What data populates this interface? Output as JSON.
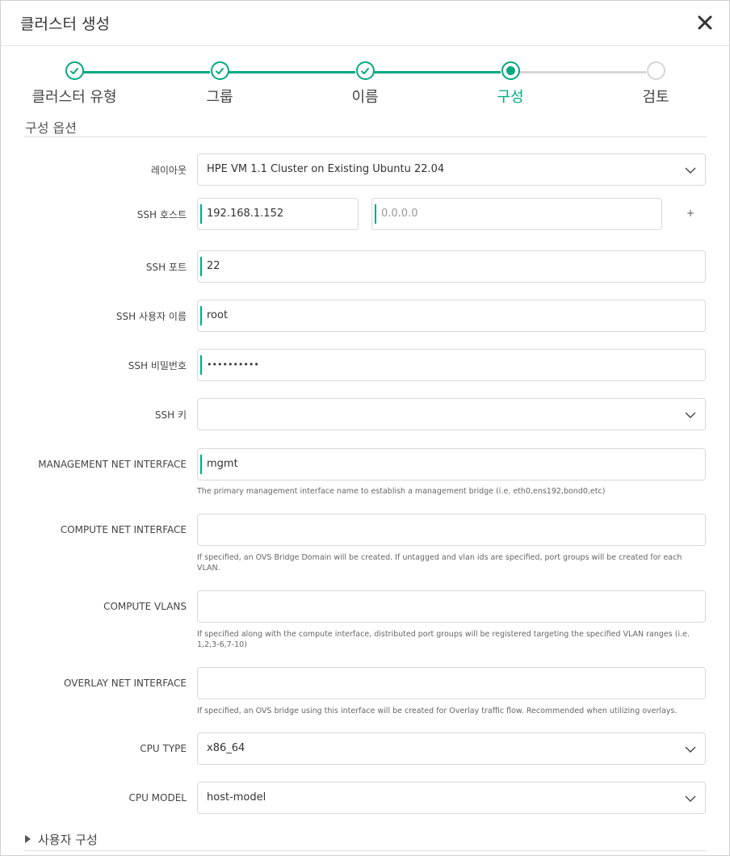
{
  "dialog": {
    "title": "클러스터 생성"
  },
  "stepper": {
    "steps": [
      {
        "label": "클러스터 유형",
        "state": "complete"
      },
      {
        "label": "그룹",
        "state": "complete"
      },
      {
        "label": "이름",
        "state": "complete"
      },
      {
        "label": "구성",
        "state": "current"
      },
      {
        "label": "검토",
        "state": "pending"
      }
    ]
  },
  "section": {
    "title": "구성 옵션",
    "user_config_label": "사용자 구성"
  },
  "form": {
    "layout": {
      "label": "레이아웃",
      "value": "HPE VM 1.1 Cluster on Existing Ubuntu 22.04"
    },
    "ssh_host": {
      "label": "SSH 호스트",
      "value": "192.168.1.152",
      "extra_placeholder": "0.0.0.0",
      "add": "+"
    },
    "ssh_port": {
      "label": "SSH 포트",
      "value": "22"
    },
    "ssh_user": {
      "label": "SSH 사용자 이름",
      "value": "root"
    },
    "ssh_password": {
      "label": "SSH 비밀번호",
      "value": "••••••••••"
    },
    "ssh_key": {
      "label": "SSH 키",
      "value": ""
    },
    "mgmt_iface": {
      "label": "MANAGEMENT NET INTERFACE",
      "value": "mgmt",
      "help": "The primary management interface name to establish a management bridge (i.e. eth0,ens192,bond0,etc)"
    },
    "compute_iface": {
      "label": "COMPUTE NET INTERFACE",
      "value": "",
      "help": "If specified, an OVS Bridge Domain will be created. If untagged and vlan ids are specified, port groups will be created for each VLAN."
    },
    "compute_vlans": {
      "label": "COMPUTE VLANS",
      "value": "",
      "help": "If specified along with the compute interface, distributed port groups will be registered targeting the specified VLAN ranges (i.e. 1,2,3-6,7-10)"
    },
    "overlay_iface": {
      "label": "OVERLAY NET INTERFACE",
      "value": "",
      "help": "If specified, an OVS bridge using this interface will be created for Overlay traffic flow. Recommended when utilizing overlays."
    },
    "cpu_type": {
      "label": "CPU TYPE",
      "value": "x86_64"
    },
    "cpu_model": {
      "label": "CPU MODEL",
      "value": "host-model"
    }
  },
  "colors": {
    "accent": "#01a982",
    "pending": "#d6d6d6"
  },
  "icons": {
    "close": "close-icon",
    "check": "check-icon",
    "dropdown": "chevron-down-icon"
  }
}
